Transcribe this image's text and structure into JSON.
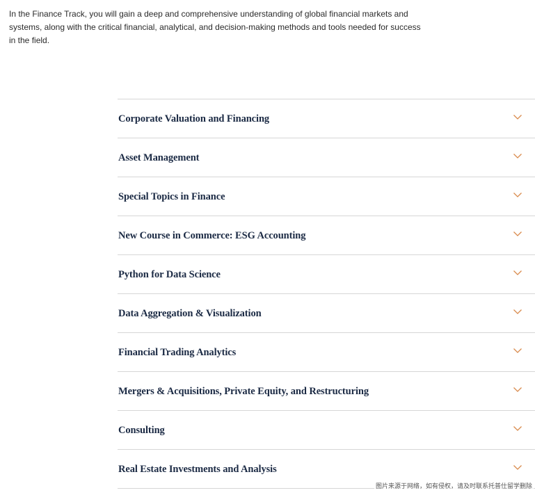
{
  "intro": {
    "text": "In the Finance Track, you will gain a deep and comprehensive understanding of global financial markets and systems, along with the critical financial, analytical, and decision-making methods and tools needed for success in the field."
  },
  "accordion": {
    "accent_color": "#d98b4d",
    "items": [
      {
        "label": "Corporate Valuation and Financing",
        "icon": "chevron-down-icon"
      },
      {
        "label": "Asset Management",
        "icon": "chevron-down-icon"
      },
      {
        "label": "Special Topics in Finance",
        "icon": "chevron-down-icon"
      },
      {
        "label": "New Course in Commerce: ESG Accounting",
        "icon": "chevron-down-icon"
      },
      {
        "label": "Python for Data Science",
        "icon": "chevron-down-icon"
      },
      {
        "label": "Data Aggregation & Visualization",
        "icon": "chevron-down-icon"
      },
      {
        "label": "Financial Trading Analytics",
        "icon": "chevron-down-icon"
      },
      {
        "label": "Mergers & Acquisitions, Private Equity, and Restructuring",
        "icon": "chevron-down-icon"
      },
      {
        "label": "Consulting",
        "icon": "chevron-down-icon"
      },
      {
        "label": "Real Estate Investments and Analysis",
        "icon": "chevron-down-icon"
      }
    ]
  },
  "watermark": {
    "text": "图片来源于网络，如有侵权，请及时联系托普仕留学删除"
  }
}
